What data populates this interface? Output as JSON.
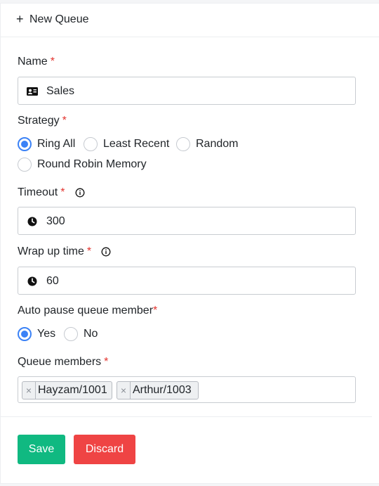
{
  "header": {
    "plus_icon": "plus-icon",
    "title": "New Queue"
  },
  "form": {
    "name": {
      "label": "Name",
      "required": "*",
      "value": "Sales",
      "icon": "id-card-icon"
    },
    "strategy": {
      "label": "Strategy",
      "required": "*",
      "options": [
        "Ring All",
        "Least Recent",
        "Random",
        "Round Robin Memory"
      ],
      "selected": "Ring All"
    },
    "timeout": {
      "label": "Timeout",
      "required": "*",
      "value": "300",
      "icon": "clock-icon",
      "info_icon": "info-icon"
    },
    "wrap_up": {
      "label": "Wrap up time",
      "required": "*",
      "value": "60",
      "icon": "clock-icon",
      "info_icon": "info-icon"
    },
    "auto_pause": {
      "label": "Auto pause queue member",
      "required": "*",
      "options": [
        "Yes",
        "No"
      ],
      "selected": "Yes"
    },
    "members": {
      "label": "Queue members",
      "required": "*",
      "remove_symbol": "×",
      "items": [
        "Hayzam/1001",
        "Arthur/1003"
      ]
    }
  },
  "buttons": {
    "save": "Save",
    "discard": "Discard"
  },
  "colors": {
    "accent": "#3b82f6",
    "required": "#e3342f",
    "save": "#10b981",
    "discard": "#ef4444"
  }
}
